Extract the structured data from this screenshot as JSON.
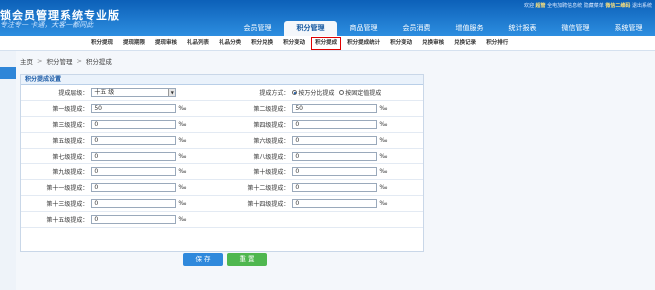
{
  "header": {
    "brand": "锁会员管理系统专业版",
    "slogan": "专注专一 卡通，大客一都同此",
    "welcome": "欢迎",
    "user": "超管",
    "links": [
      "全电加聘信息统",
      "隐藏菜单",
      "微信二维码",
      "退出系统"
    ]
  },
  "main_nav": [
    "会员管理",
    "积分管理",
    "商品管理",
    "会员消费",
    "增值服务",
    "统计报表",
    "微信管理",
    "系统管理"
  ],
  "main_nav_active": 1,
  "sub_nav": [
    "积分提现",
    "提现期限",
    "提现审核",
    "礼品列表",
    "礼品分类",
    "积分兑换",
    "积分变动",
    "积分提成",
    "积分提成统计",
    "积分变动",
    "兑换审核",
    "兑换记录",
    "积分排行"
  ],
  "sub_nav_active": 7,
  "breadcrumb": [
    "主页",
    "积分管理",
    "积分提成"
  ],
  "breadcrumb_sep": ">",
  "panel": {
    "title": "积分提成设置",
    "level_label": "提成层级：",
    "level_value": "十五 级",
    "method_label": "提成方式：",
    "method_options": [
      "按万分比提成",
      "按固定值提成"
    ],
    "method_selected": 0,
    "unit": "‰",
    "rows": [
      [
        {
          "label": "第一级提成：",
          "value": "50"
        },
        {
          "label": "第二级提成：",
          "value": "50"
        }
      ],
      [
        {
          "label": "第三级提成：",
          "value": "0"
        },
        {
          "label": "第四级提成：",
          "value": "0"
        }
      ],
      [
        {
          "label": "第五级提成：",
          "value": "0"
        },
        {
          "label": "第六级提成：",
          "value": "0"
        }
      ],
      [
        {
          "label": "第七级提成：",
          "value": "0"
        },
        {
          "label": "第八级提成：",
          "value": "0"
        }
      ],
      [
        {
          "label": "第九级提成：",
          "value": "0"
        },
        {
          "label": "第十级提成：",
          "value": "0"
        }
      ],
      [
        {
          "label": "第十一级提成：",
          "value": "0"
        },
        {
          "label": "第十二级提成：",
          "value": "0"
        }
      ],
      [
        {
          "label": "第十三级提成：",
          "value": "0"
        },
        {
          "label": "第十四级提成：",
          "value": "0"
        }
      ],
      [
        {
          "label": "第十五级提成：",
          "value": "0"
        }
      ]
    ]
  },
  "buttons": {
    "save": "保 存",
    "reset": "重 置"
  },
  "colors": {
    "header": "#1f7fd6",
    "active_outline": "#e00000",
    "save": "#2f89dc",
    "reset": "#4fb74f"
  }
}
